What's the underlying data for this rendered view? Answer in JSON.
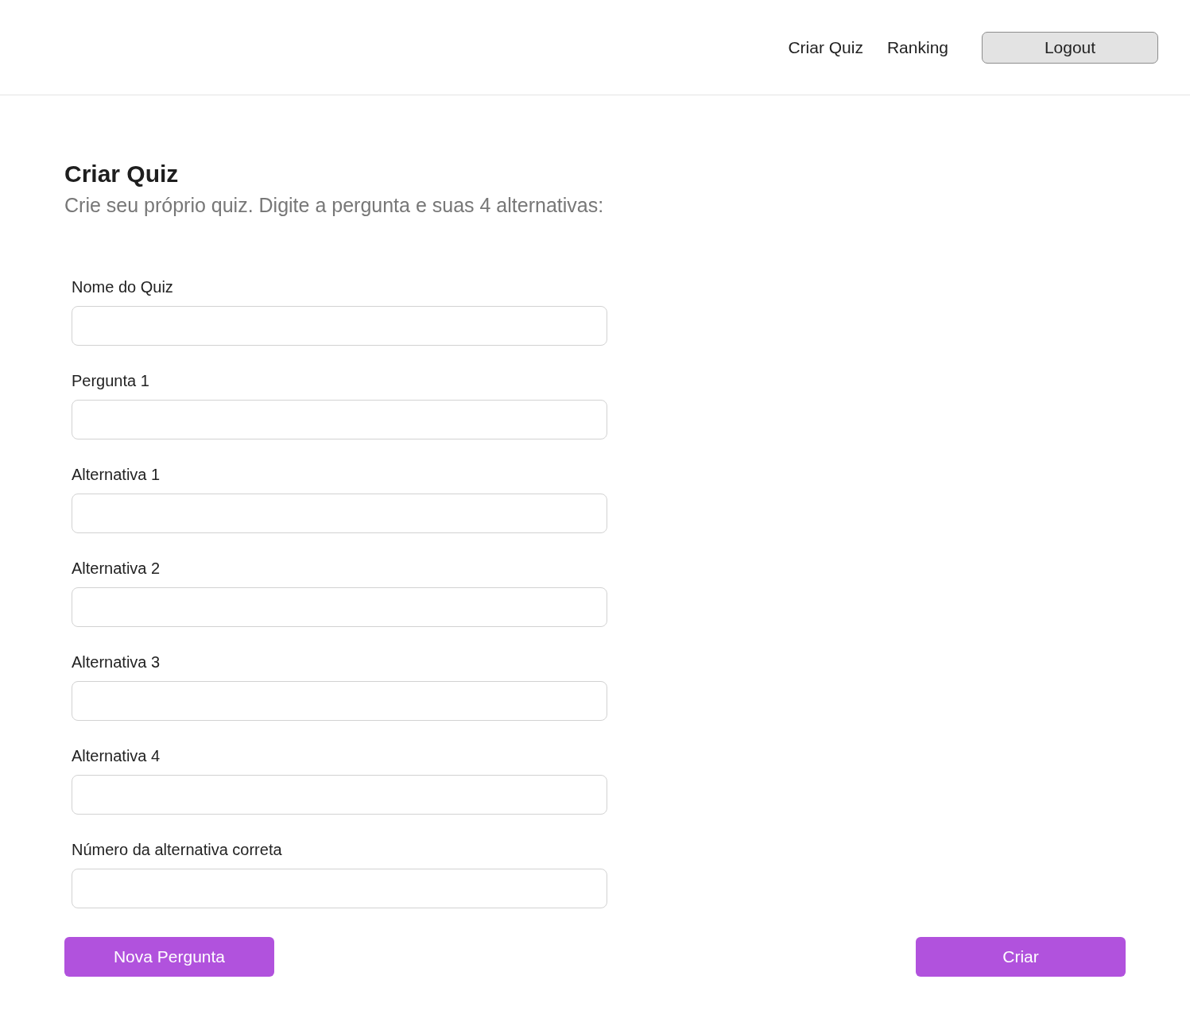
{
  "nav": {
    "links": [
      {
        "label": "Criar Quiz"
      },
      {
        "label": "Ranking"
      }
    ],
    "logout": "Logout"
  },
  "heading": "Criar Quiz",
  "subtitle": "Crie seu próprio quiz. Digite a pergunta e suas 4 alternativas:",
  "fields": [
    {
      "label": "Nome do Quiz"
    },
    {
      "label": "Pergunta 1"
    },
    {
      "label": "Alternativa 1"
    },
    {
      "label": "Alternativa 2"
    },
    {
      "label": "Alternativa 3"
    },
    {
      "label": "Alternativa 4"
    },
    {
      "label": "Número da alternativa correta"
    }
  ],
  "buttons": {
    "new_question": "Nova Pergunta",
    "create": "Criar"
  }
}
